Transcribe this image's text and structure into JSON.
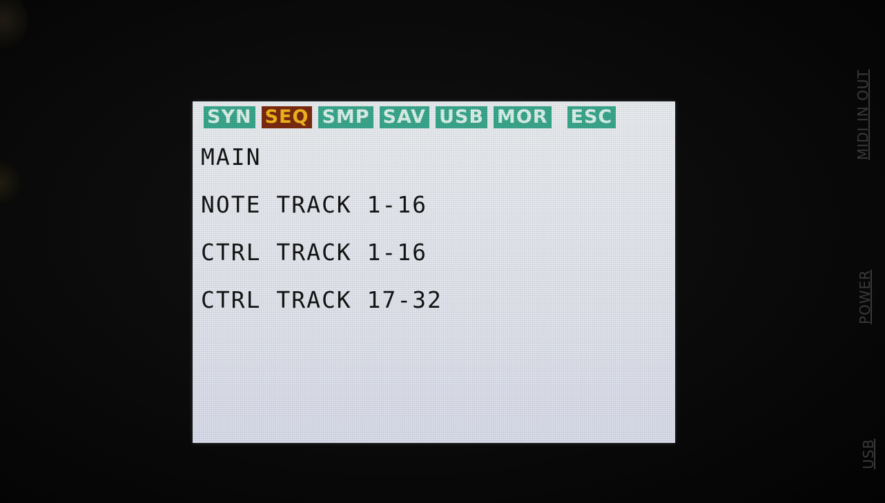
{
  "side_labels": {
    "midi": "MIDI IN OUT",
    "power": "POWER",
    "usb": "USB"
  },
  "tabs": [
    {
      "label": "SYN",
      "active": false
    },
    {
      "label": "SEQ",
      "active": true
    },
    {
      "label": "SMP",
      "active": false
    },
    {
      "label": "SAV",
      "active": false
    },
    {
      "label": "USB",
      "active": false
    },
    {
      "label": "MOR",
      "active": false
    },
    {
      "label": "ESC",
      "active": false
    }
  ],
  "menu": {
    "items": [
      {
        "label": "MAIN"
      },
      {
        "label": "NOTE TRACK 1-16"
      },
      {
        "label": "CTRL TRACK 1-16"
      },
      {
        "label": "CTRL TRACK 17-32"
      }
    ]
  },
  "colors": {
    "tab_bg": "#3aa68c",
    "tab_active_bg": "#7a2a10",
    "tab_active_text": "#f1b51c",
    "screen_bg": "#e5e8ee",
    "text": "#141414"
  }
}
